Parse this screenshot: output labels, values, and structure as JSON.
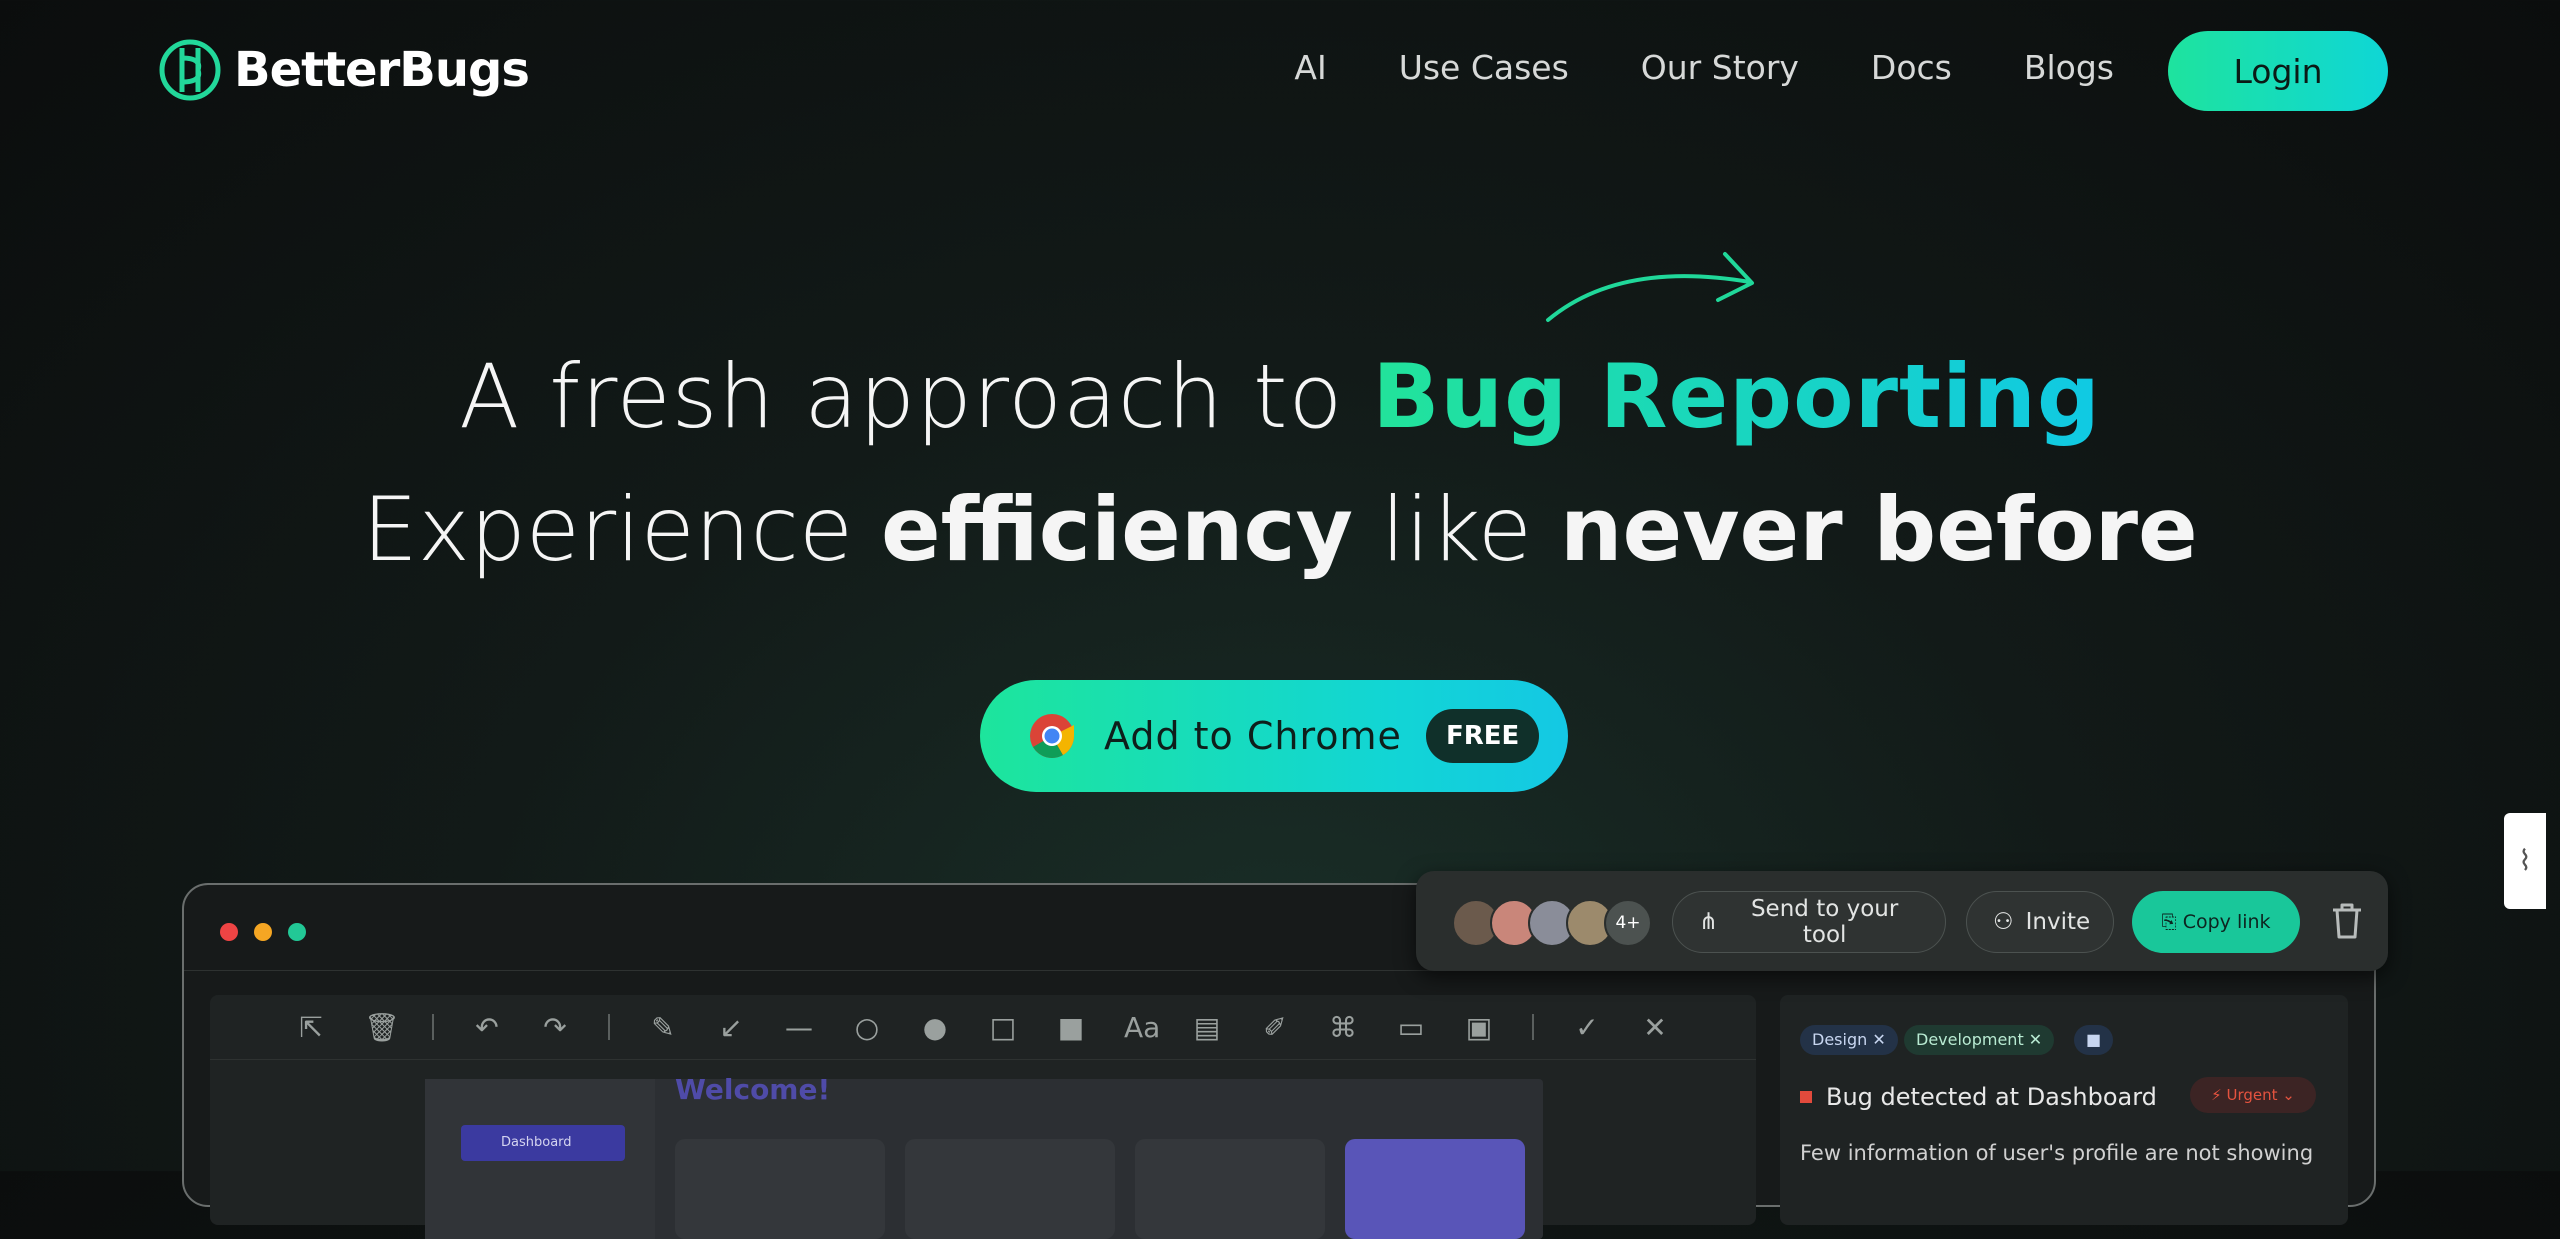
{
  "brand": {
    "name": "BetterBugs",
    "accent_start": "#1ee39e",
    "accent_end": "#10c9e4"
  },
  "nav": {
    "links": [
      "AI",
      "Use Cases",
      "Our Story",
      "Docs",
      "Blogs"
    ],
    "login_label": "Login"
  },
  "hero": {
    "line1_plain": "A fresh approach to ",
    "line1_highlight": "Bug Reporting",
    "line2_a": "Experience ",
    "line2_b": "efficiency",
    "line2_c": " like ",
    "line2_d": "never before"
  },
  "cta": {
    "label": "Add to Chrome",
    "badge": "FREE",
    "icon": "chrome-icon"
  },
  "share_bar": {
    "more_count": "4+",
    "send_label": "Send to your tool",
    "invite_label": "Invite",
    "copy_label": "Copy link"
  },
  "mock": {
    "window_dots": [
      "#ef4444",
      "#f5a623",
      "#22c896"
    ],
    "toolbar_icons": [
      "cursor-icon",
      "trash-icon",
      "undo-icon",
      "redo-icon",
      "pencil-icon",
      "arrow-icon",
      "line-icon",
      "circle-icon",
      "filled-circle-icon",
      "square-icon",
      "filled-square-icon",
      "text-icon",
      "comment-icon",
      "highlighter-icon",
      "crop-icon",
      "blur-icon",
      "frame-icon",
      "check-icon",
      "close-icon"
    ],
    "screen_welcome": "Welcome!",
    "screen_dashboard": "Dashboard",
    "tags": [
      "Design",
      "Development"
    ],
    "bug_title": "Bug detected at Dashboard",
    "priority": "Urgent",
    "bug_desc": "Few information of user's profile are not showing"
  }
}
